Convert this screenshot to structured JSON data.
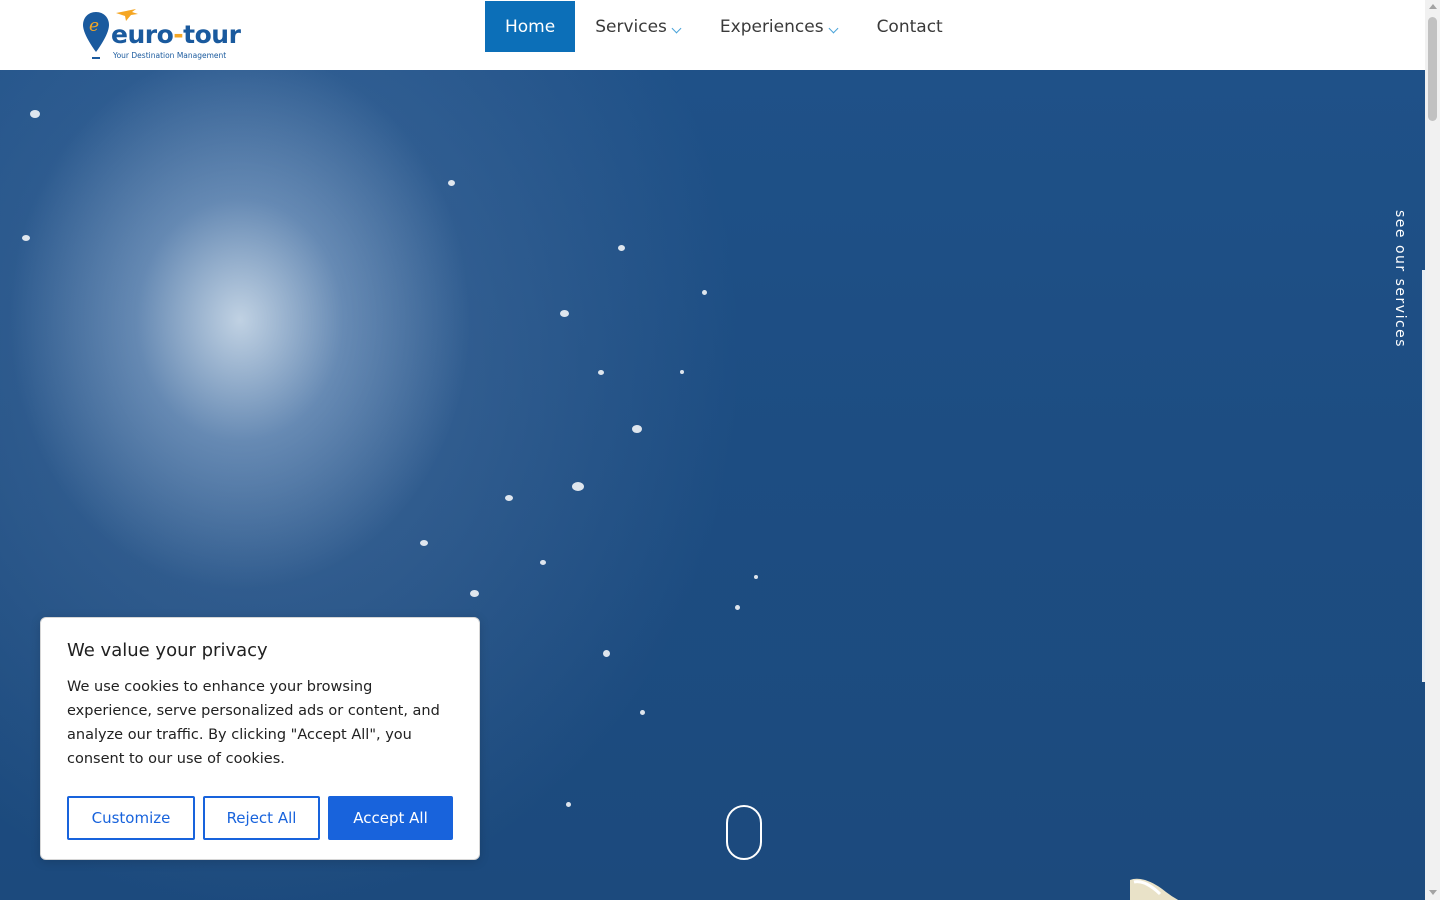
{
  "header": {
    "logo": {
      "name": "euro",
      "dash": "-",
      "name2": "tour",
      "tagline": "Your Destination Management"
    },
    "nav": [
      {
        "label": "Home",
        "active": true,
        "dropdown": false
      },
      {
        "label": "Services",
        "active": false,
        "dropdown": true
      },
      {
        "label": "Experiences",
        "active": false,
        "dropdown": true
      },
      {
        "label": "Contact",
        "active": false,
        "dropdown": false
      }
    ]
  },
  "hero": {
    "side_link": "see our services",
    "scroll_icon": "mouse-scroll-icon"
  },
  "cookie_banner": {
    "title": "We value your privacy",
    "text": "We use cookies to enhance your browsing experience, serve personalized ads or content, and analyze our traffic. By clicking \"Accept All\", you consent to our use of cookies.",
    "buttons": {
      "customize": "Customize",
      "reject": "Reject All",
      "accept": "Accept All"
    }
  },
  "colors": {
    "nav_active": "#0c6fb8",
    "brand_blue": "#1a5a9e",
    "accent_orange": "#f5a623",
    "cookie_button": "#1863dc",
    "sea": "#1d4e84"
  }
}
